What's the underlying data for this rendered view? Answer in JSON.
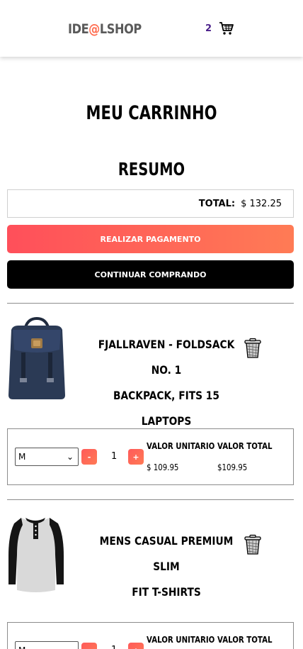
{
  "header": {
    "logo_prefix": "IDE",
    "logo_at": "@",
    "logo_suffix": "LSHOP",
    "cart_count": "2",
    "cart_icon": "shopping-cart-icon",
    "brand_color": "#ff6a4d",
    "count_color": "#4a1f8a"
  },
  "page": {
    "title": "MEU CARRINHO",
    "summary_title": "RESUMO"
  },
  "summary": {
    "total_label": "TOTAL:",
    "total_value": "$ 132.25",
    "pay_button": "REALIZAR PAGAMENTO",
    "continue_button": "CONTINUAR COMPRANDO",
    "pay_gradient": [
      "#ff4f5a",
      "#ff7b55"
    ]
  },
  "items": [
    {
      "title_line1": "FJALLRAVEN - FOLDSACK NO. 1",
      "title_line2": "BACKPACK, FITS 15 LAPTOPS",
      "image_icon": "backpack-image",
      "size": "M",
      "minus": "-",
      "quantity": "1",
      "plus": "+",
      "unit_label": "VALOR UNITARIO",
      "unit_value": "$ 109.95",
      "total_label": "VALOR TOTAL",
      "total_value": "$109.95"
    },
    {
      "title_line1": "MENS CASUAL PREMIUM SLIM",
      "title_line2": "FIT T-SHIRTS",
      "image_icon": "tshirt-image",
      "size": "M",
      "minus": "-",
      "quantity": "1",
      "plus": "+",
      "unit_label": "VALOR UNITARIO",
      "total_label": "VALOR TOTAL"
    }
  ]
}
